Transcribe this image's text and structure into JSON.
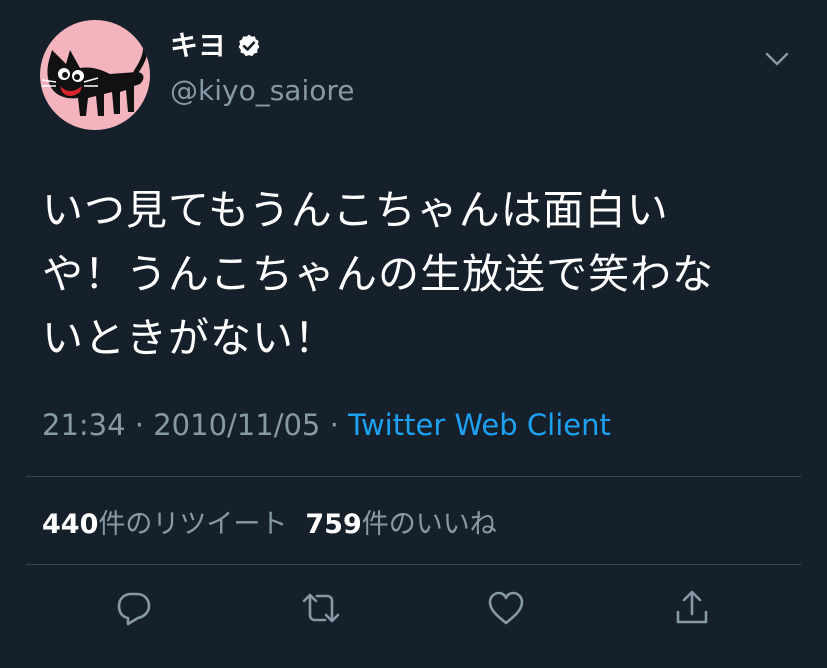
{
  "author": {
    "display_name": "キヨ",
    "handle": "@kiyo_saiore",
    "verified": true
  },
  "tweet": {
    "lines": [
      "いつ見てもうんこちゃんは面白い",
      "や！うんこちゃんの生放送で笑わな",
      "いときがない！"
    ]
  },
  "meta": {
    "time": "21:34",
    "separator": " · ",
    "date": "2010/11/05",
    "client": "Twitter Web Client"
  },
  "stats": {
    "retweet_count": "440",
    "retweet_label": "件のリツイート",
    "like_count": "759",
    "like_label": "件のいいね"
  },
  "actions": [
    {
      "icon": "reply-icon"
    },
    {
      "icon": "retweet-icon"
    },
    {
      "icon": "like-icon"
    },
    {
      "icon": "share-icon"
    }
  ],
  "colors": {
    "background": "#15202b",
    "secondary_text": "#8899a6",
    "link": "#1da1f2",
    "divider": "#38444d"
  }
}
